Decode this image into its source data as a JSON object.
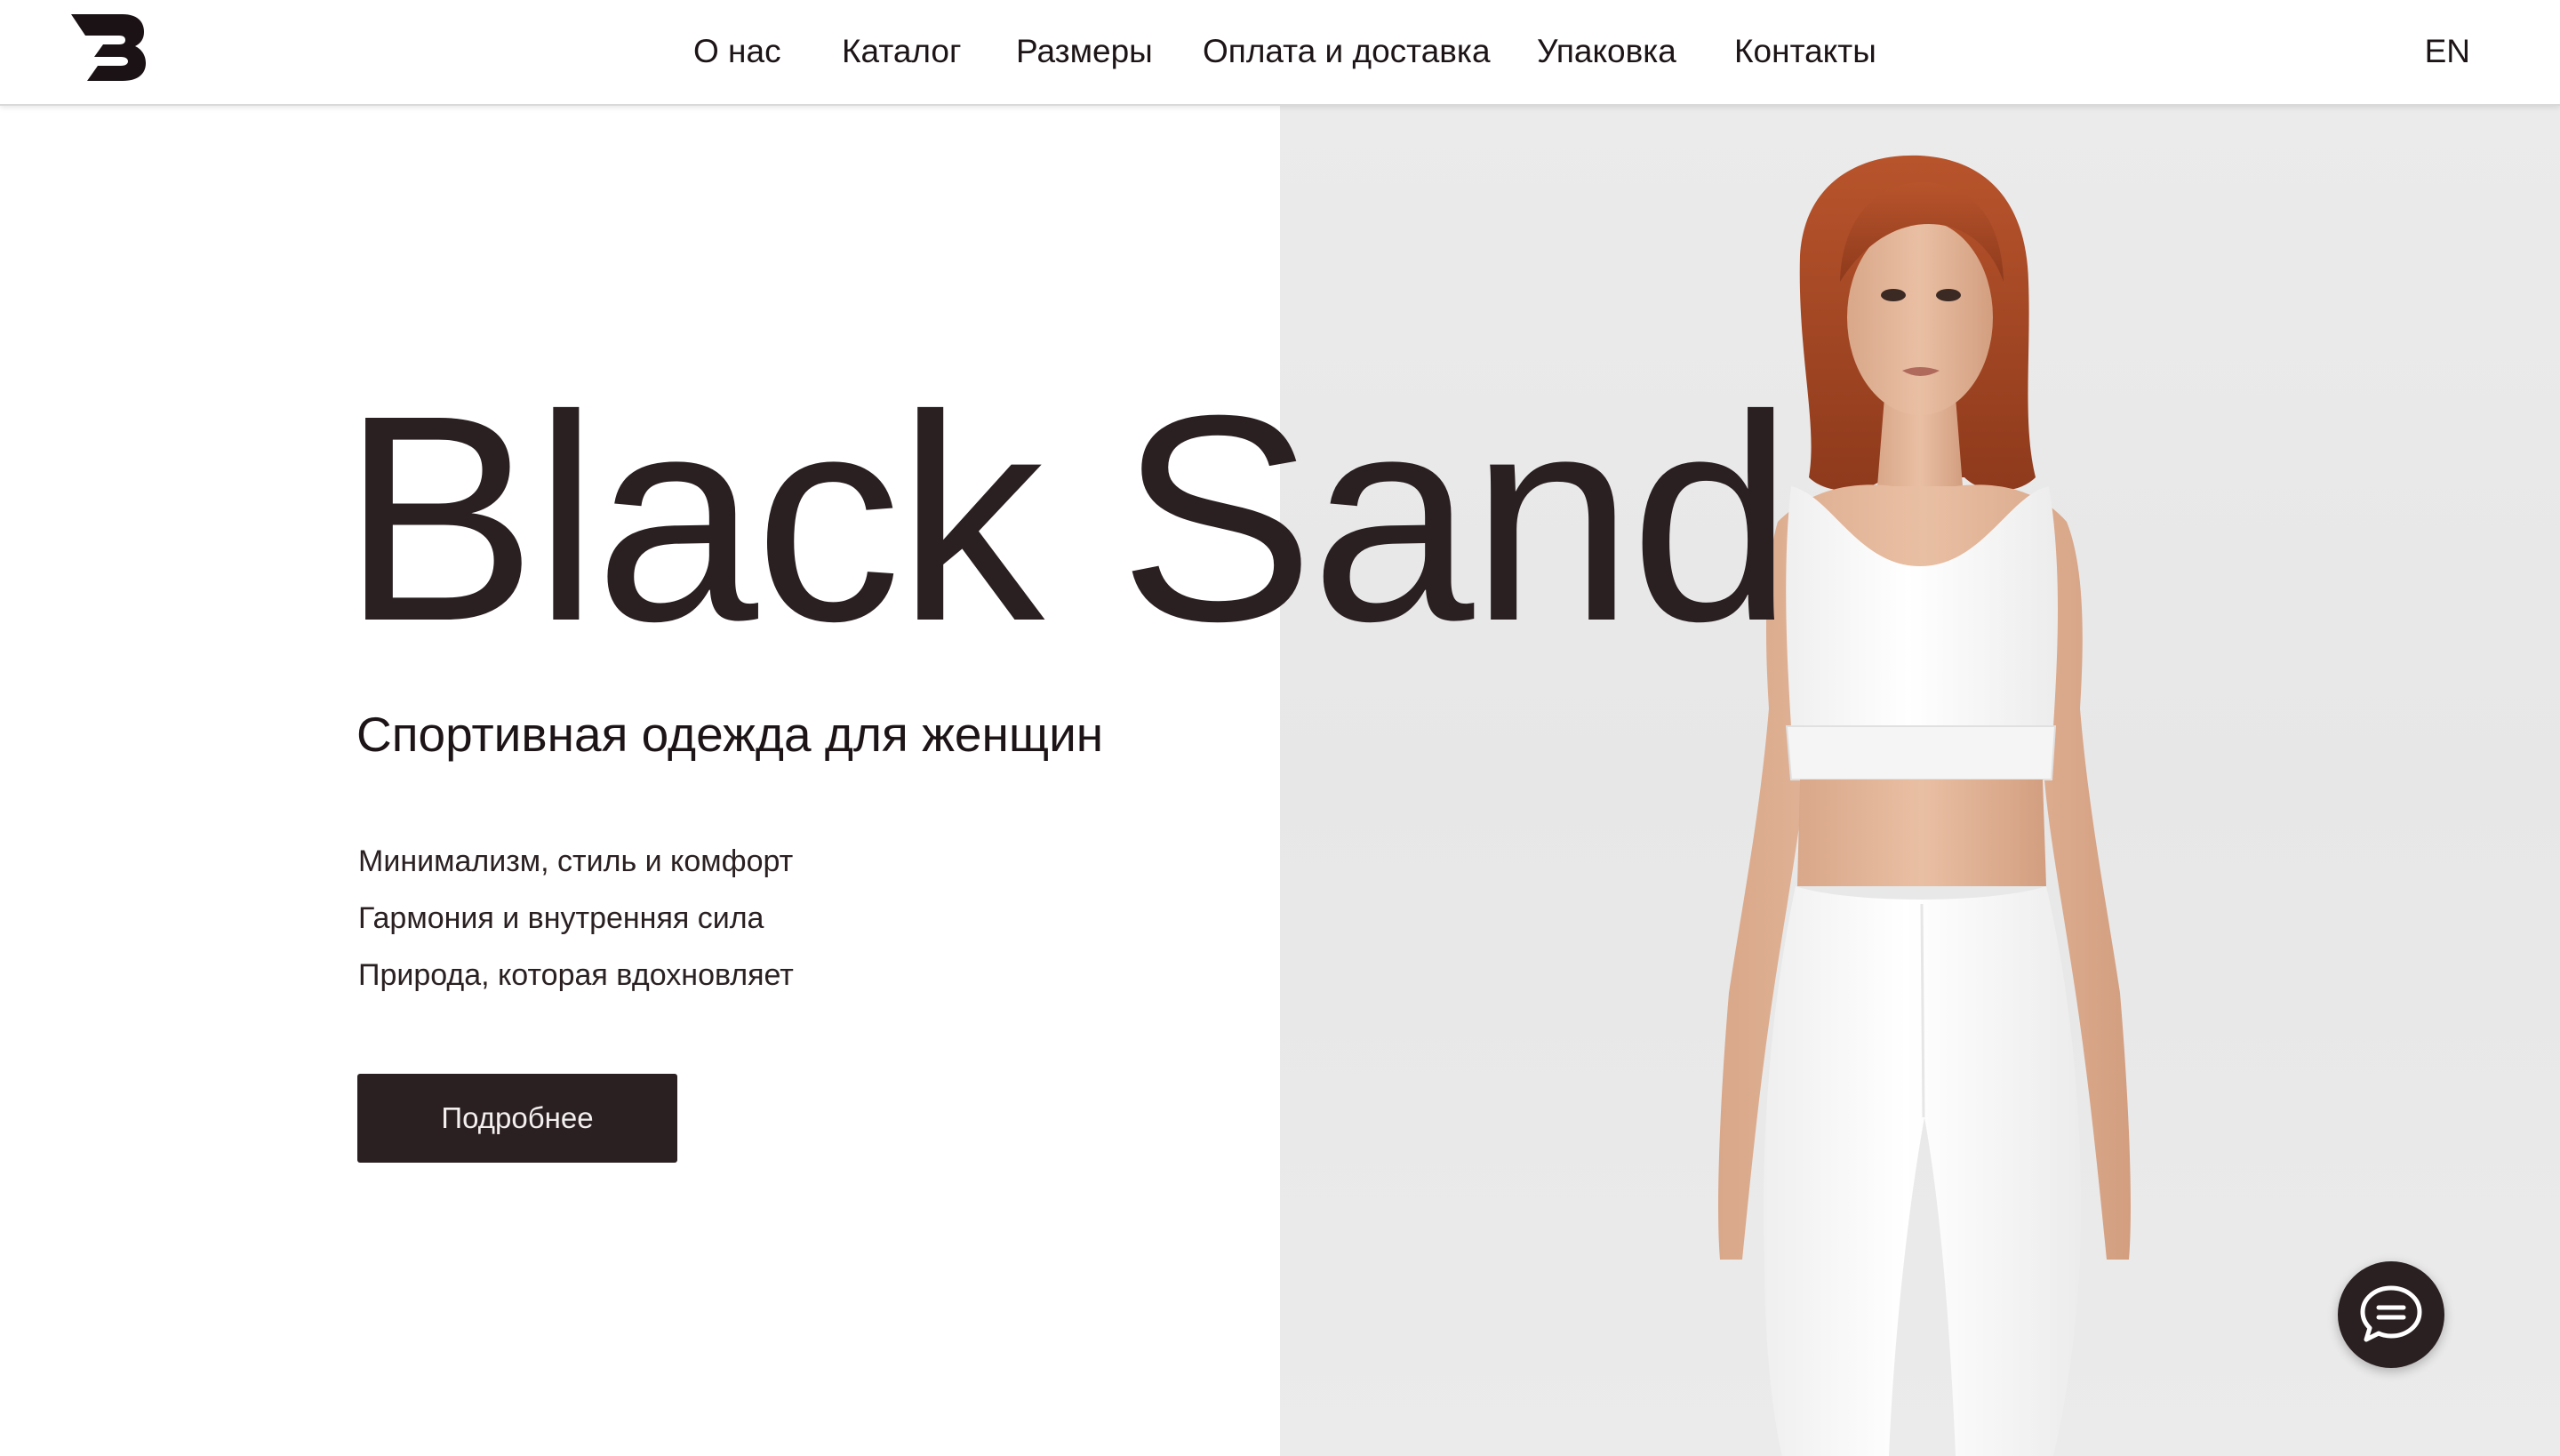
{
  "header": {
    "logo_icon": "brand-logo-b-icon",
    "nav": [
      {
        "label": "О нас"
      },
      {
        "label": "Каталог"
      },
      {
        "label": "Размеры"
      },
      {
        "label": "Оплата и доставка"
      },
      {
        "label": "Упаковка"
      },
      {
        "label": "Контакты"
      }
    ],
    "language": "EN"
  },
  "hero": {
    "title": "Black Sand",
    "subtitle": "Спортивная одежда для женщин",
    "features": [
      "Минимализм, стиль и комфорт",
      "Гармония и внутренняя сила",
      "Природа, которая вдохновляет"
    ],
    "cta_label": "Подробнее"
  },
  "chat": {
    "icon": "chat-bubble-icon"
  },
  "colors": {
    "primary_dark": "#2a2022",
    "background": "#ffffff",
    "photo_background": "#ebebeb"
  }
}
